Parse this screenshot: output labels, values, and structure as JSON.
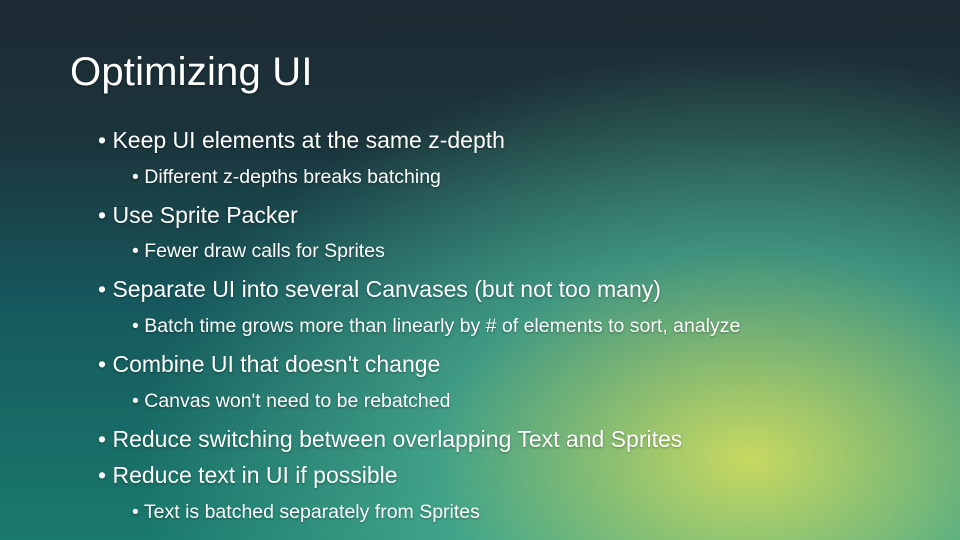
{
  "slide": {
    "title": "Optimizing UI",
    "bullets": [
      {
        "text": "Keep UI elements at the same z-depth",
        "sub": [
          "Different z-depths breaks batching"
        ]
      },
      {
        "text": "Use Sprite Packer",
        "sub": [
          "Fewer draw calls for Sprites"
        ]
      },
      {
        "text": "Separate UI into several Canvases (but not too many)",
        "sub": [
          "Batch time grows more than linearly by # of elements to sort, analyze"
        ]
      },
      {
        "text": "Combine UI that doesn't change",
        "sub": [
          "Canvas won't need to be rebatched"
        ]
      },
      {
        "text": "Reduce switching between overlapping Text and Sprites",
        "sub": []
      },
      {
        "text": "Reduce text in UI if possible",
        "sub": [
          "Text is batched separately from Sprites"
        ]
      }
    ]
  }
}
